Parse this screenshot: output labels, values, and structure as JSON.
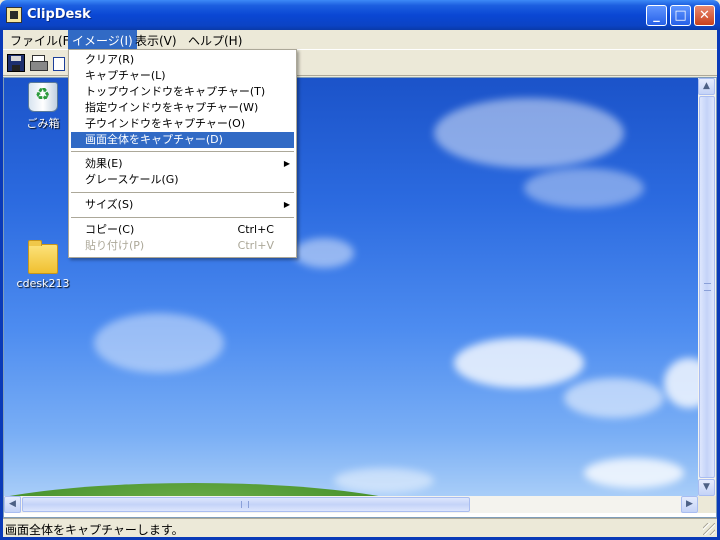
{
  "window": {
    "title": "ClipDesk",
    "minimize_symbol": "_",
    "maximize_symbol": "□",
    "close_symbol": "✕"
  },
  "menubar": {
    "items": [
      {
        "label": "ファイル(F)"
      },
      {
        "label": "イメージ(I)",
        "active": true
      },
      {
        "label": "表示(V)"
      },
      {
        "label": "ヘルプ(H)"
      }
    ]
  },
  "toolbar": {
    "icons": [
      "save-icon",
      "print-icon",
      "copy-icon"
    ]
  },
  "image_menu": {
    "items": [
      {
        "label": "クリア(R)"
      },
      {
        "label": "キャプチャー(L)"
      },
      {
        "label": "トップウインドウをキャプチャー(T)"
      },
      {
        "label": "指定ウインドウをキャプチャー(W)"
      },
      {
        "label": "子ウインドウをキャプチャー(O)"
      },
      {
        "label": "画面全体をキャプチャー(D)",
        "selected": true
      },
      {
        "label": "効果(E)",
        "submenu": true
      },
      {
        "label": "グレースケール(G)"
      },
      {
        "label": "サイズ(S)",
        "submenu": true
      },
      {
        "label": "コピー(C)",
        "shortcut": "Ctrl+C"
      },
      {
        "label": "貼り付け(P)",
        "shortcut": "Ctrl+V",
        "disabled": true
      }
    ],
    "submenu_arrow": "▶"
  },
  "desktop_icons": [
    {
      "label": "ごみ箱",
      "icon": "recycle-bin-icon"
    },
    {
      "label": "cdesk213",
      "icon": "folder-icon"
    }
  ],
  "scrollbars": {
    "up_arrow": "▲",
    "down_arrow": "▼",
    "left_arrow": "◀",
    "right_arrow": "▶"
  },
  "statusbar": {
    "text": "画面全体をキャプチャーします。"
  },
  "colors": {
    "titlebar": "#0a47d4",
    "menu_highlight": "#316ac5",
    "chrome": "#ece9d8"
  }
}
